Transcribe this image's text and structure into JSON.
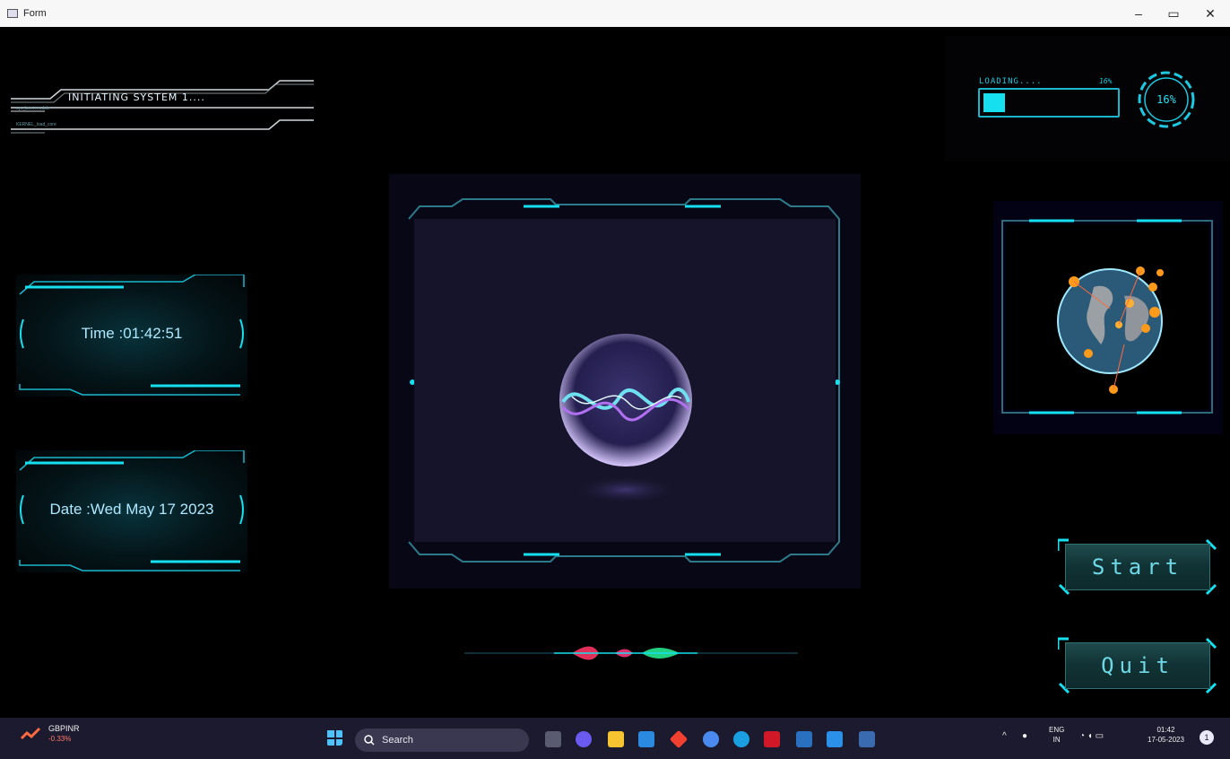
{
  "window": {
    "title": "Form",
    "minimize_label": "–",
    "restore_label": "▭",
    "close_label": "✕"
  },
  "hud": {
    "init_text": "INITIATING SYSTEM 1....",
    "init_small_1": "sys_boot.module",
    "init_small_2": "KERNEL_load_core",
    "loading_label": "LOADING....",
    "loading_small": "16%",
    "loading_fraction": 0.16,
    "ring_label": "16%",
    "time_text": "Time :01:42:51",
    "date_text": "Date :Wed May 17 2023",
    "start_label": "Start",
    "quit_label": "Quit",
    "accent_color": "#16e0f0"
  },
  "taskbar": {
    "stock_symbol": "GBPINR",
    "stock_change": "-0.33%",
    "search_label": "Search",
    "lang_top": "ENG",
    "lang_bottom": "IN",
    "clock_time": "01:42",
    "clock_date": "17-05-2023",
    "notification_count": "1",
    "apps": [
      "windows-start-icon",
      "task-view-icon",
      "teams-chat-icon",
      "file-explorer-icon",
      "mail-icon",
      "red-diamond-app-icon",
      "chrome-icon",
      "edge-icon",
      "mcafee-icon",
      "store-icon",
      "vscode-icon",
      "python-app-icon"
    ]
  }
}
